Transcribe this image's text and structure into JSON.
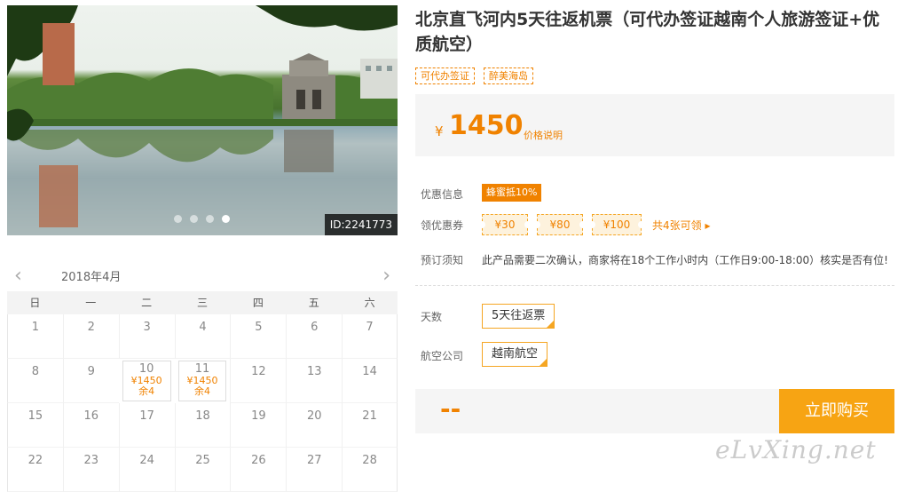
{
  "hero": {
    "id_label": "ID:2241773",
    "slide_count": 4,
    "active_slide": 4
  },
  "calendar": {
    "prev_icon": "chevron-left-icon",
    "next_icon": "chevron-right-icon",
    "month": "2018年4月",
    "weekdays": [
      "日",
      "一",
      "二",
      "三",
      "四",
      "五",
      "六"
    ],
    "days": [
      {
        "day": "1"
      },
      {
        "day": "2"
      },
      {
        "day": "3"
      },
      {
        "day": "4"
      },
      {
        "day": "5"
      },
      {
        "day": "6"
      },
      {
        "day": "7"
      },
      {
        "day": "8"
      },
      {
        "day": "9"
      },
      {
        "day": "10",
        "price": "¥1450",
        "stock": "余4"
      },
      {
        "day": "11",
        "price": "¥1450",
        "stock": "余4"
      },
      {
        "day": "12"
      },
      {
        "day": "13"
      },
      {
        "day": "14"
      },
      {
        "day": "15"
      },
      {
        "day": "16"
      },
      {
        "day": "17"
      },
      {
        "day": "18"
      },
      {
        "day": "19"
      },
      {
        "day": "20"
      },
      {
        "day": "21"
      },
      {
        "day": "22"
      },
      {
        "day": "23"
      },
      {
        "day": "24"
      },
      {
        "day": "25"
      },
      {
        "day": "26"
      },
      {
        "day": "27"
      },
      {
        "day": "28"
      }
    ]
  },
  "product": {
    "title": "北京直飞河内5天往返机票（可代办签证越南个人旅游签证+优质航空）",
    "tags": [
      "可代办签证",
      "醉美海岛"
    ]
  },
  "price": {
    "currency": "¥",
    "amount": "1450",
    "note": "价格说明"
  },
  "promo": {
    "label": "优惠信息",
    "badge": "蜂蜜抵10%"
  },
  "coupons": {
    "label": "领优惠券",
    "items": [
      "¥30",
      "¥80",
      "¥100"
    ],
    "more": "共4张可领 ▸"
  },
  "booking": {
    "label": "预订须知",
    "text": "此产品需要二次确认，商家将在18个工作小时内（工作日9:00-18:00）核实是否有位!"
  },
  "days_option": {
    "label": "天数",
    "value": "5天往返票"
  },
  "airline_option": {
    "label": "航空公司",
    "value": "越南航空"
  },
  "buy": {
    "total": "--",
    "button": "立即购买"
  },
  "watermark": "eLvXing.net",
  "colors": {
    "accent": "#f08200",
    "button": "#f7a413",
    "panel_bg": "#f5f5f5"
  }
}
